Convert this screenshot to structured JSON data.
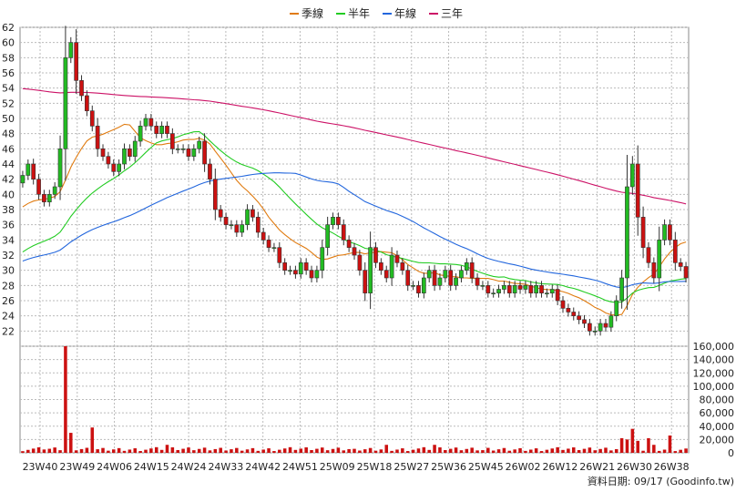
{
  "chart_data": {
    "type": "candlestick",
    "legend": [
      {
        "name": "季線",
        "color": "#e07b10"
      },
      {
        "name": "半年",
        "color": "#22cc22"
      },
      {
        "name": "年線",
        "color": "#2266dd"
      },
      {
        "name": "三年",
        "color": "#cc1166"
      }
    ],
    "price_axis": {
      "min": 20,
      "max": 62,
      "ticks": [
        22,
        24,
        26,
        28,
        30,
        32,
        34,
        36,
        38,
        40,
        42,
        44,
        46,
        48,
        50,
        52,
        54,
        56,
        58,
        60,
        62
      ]
    },
    "volume_axis": {
      "min": 0,
      "max": 160000,
      "ticks": [
        0,
        20000,
        40000,
        60000,
        80000,
        100000,
        120000,
        140000,
        160000
      ],
      "tick_labels": [
        "0",
        "20,000",
        "40,000",
        "60,000",
        "80,000",
        "100,000",
        "120,000",
        "140,000",
        "160,000"
      ]
    },
    "x_ticks": [
      "23W40",
      "23W49",
      "24W06",
      "24W15",
      "24W24",
      "24W33",
      "24W42",
      "24W51",
      "25W09",
      "25W18",
      "25W27",
      "25W36",
      "25W45",
      "26W02",
      "26W12",
      "26W21",
      "26W30",
      "26W38"
    ],
    "footer": "資料日期: 09/17  (Goodinfo.tw)",
    "colors": {
      "up": "#22bb22",
      "down": "#cc1111",
      "volume": "#cc1111",
      "grid": "#bbbbbb"
    },
    "close": [
      42.5,
      44,
      42,
      40,
      39,
      40,
      41,
      46,
      58,
      60,
      55,
      53,
      51,
      49,
      46,
      45,
      44,
      43,
      44,
      46,
      45,
      47,
      49,
      50,
      49,
      48,
      49,
      48,
      46,
      46,
      46,
      45,
      46,
      47,
      44,
      42,
      38,
      37,
      36,
      36,
      35,
      36,
      38,
      37,
      35,
      34,
      33,
      33,
      31,
      30,
      30,
      29.5,
      31,
      30,
      29,
      30,
      33,
      36,
      37,
      36,
      34,
      33,
      32,
      30,
      27,
      33,
      31,
      30,
      29,
      32,
      31,
      30,
      28,
      28,
      27,
      29,
      30,
      28,
      29,
      30,
      28,
      29,
      30,
      31,
      29,
      28,
      28,
      27,
      27,
      27.5,
      28,
      27,
      28,
      27.5,
      28,
      27,
      28,
      27,
      27,
      27.5,
      26,
      25,
      24.5,
      24,
      23.5,
      23,
      22,
      22,
      23,
      22.5,
      24,
      26,
      29,
      41,
      44,
      37,
      33,
      31,
      29,
      34,
      36,
      34,
      31,
      30.5,
      29
    ],
    "vol_spikes": {
      "4": 5000,
      "8": 160000,
      "9": 30000,
      "13": 38000,
      "27": 12000,
      "62": 6000,
      "68": 12000,
      "77": 12000,
      "86": 4000,
      "112": 22000,
      "113": 20000,
      "114": 36000,
      "115": 18000,
      "117": 22000,
      "118": 12000,
      "121": 26000
    }
  }
}
